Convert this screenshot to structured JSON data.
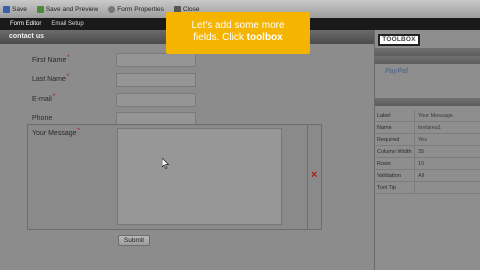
{
  "toolbar": {
    "buttons": [
      {
        "label": "Save",
        "icon": "disk-icon",
        "color": "#3b5fa6"
      },
      {
        "label": "Save and Preview",
        "icon": "preview-icon",
        "color": "#4f8a3b"
      },
      {
        "label": "Form Properties",
        "icon": "gear-icon",
        "color": "#777777"
      },
      {
        "label": "Close",
        "icon": "back-icon",
        "color": "#555555"
      }
    ]
  },
  "menu": {
    "items": [
      "Form Editor",
      "Email Setup"
    ]
  },
  "header": {
    "title": "contact us"
  },
  "form": {
    "fields": [
      {
        "label": "First Name",
        "required": "*"
      },
      {
        "label": "Last Name",
        "required": "*"
      },
      {
        "label": "E-mail",
        "required": "*"
      },
      {
        "label": "Phone",
        "required": ""
      }
    ],
    "message_label": "Your Message",
    "message_required": "*",
    "delete_icon": "×",
    "submit_label": "Submit"
  },
  "sidebar": {
    "toolbox_label": "TOOLBOX",
    "paypal_label": "PayPal",
    "properties": [
      {
        "key": "Label",
        "value": "Your Message"
      },
      {
        "key": "Name",
        "value": "textarea1"
      },
      {
        "key": "Required",
        "value": "Yes"
      },
      {
        "key": "Column Width",
        "value": "35"
      },
      {
        "key": "Rows",
        "value": "10"
      },
      {
        "key": "Validation",
        "value": "All"
      },
      {
        "key": "Tool Tip",
        "value": ""
      }
    ]
  },
  "tooltip": {
    "line1": "Let's add some more",
    "line2_prefix": "fields. Click ",
    "line2_bold": "toolbox"
  },
  "colors": {
    "tooltip_bg": "#f5b400",
    "required_star": "#a01010",
    "delete_x": "#b11a1a"
  }
}
